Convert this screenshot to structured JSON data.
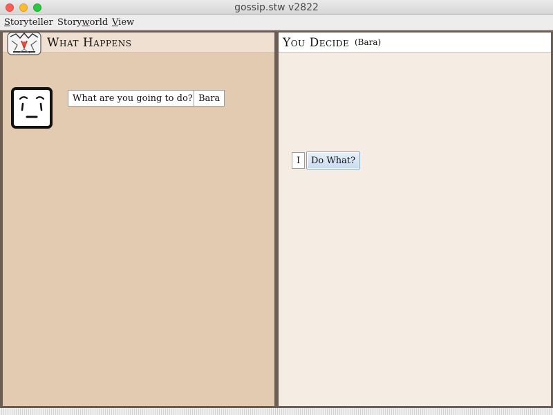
{
  "window": {
    "title": "gossip.stw v2822"
  },
  "menubar": {
    "items": [
      {
        "mnemonic": "S",
        "rest": "toryteller"
      },
      {
        "pre": "Story",
        "mnemonic": "w",
        "rest": "orld"
      },
      {
        "mnemonic": "V",
        "rest": "iew"
      }
    ]
  },
  "left_pane": {
    "title": "What Happens",
    "speech_button": "What are you going to do?",
    "speaker_button": "Bara"
  },
  "right_pane": {
    "title": "You Decide",
    "subtitle": "(Bara)",
    "word_button": "I",
    "action_button": "Do What?"
  },
  "colors": {
    "left_bg": "#e3cbb1",
    "right_bg": "#f5ece4",
    "frame": "#6b5f55",
    "action_button_bg": "#c9dbf0"
  },
  "icons": [
    "logo-icon",
    "character-face-icon"
  ]
}
